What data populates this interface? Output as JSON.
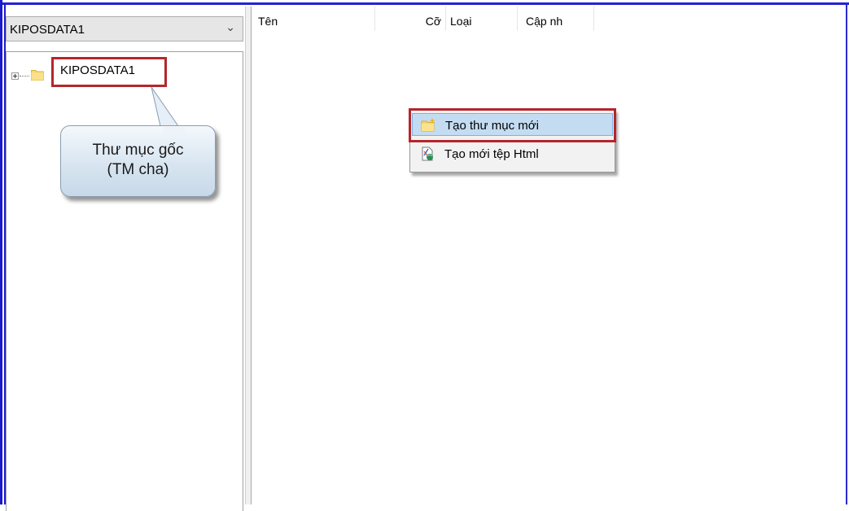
{
  "tree_panel": {
    "combo_value": "KIPOSDATA1",
    "combo_arrow_icon": "chevron-down-icon",
    "root_node_label": "KIPOSDATA1"
  },
  "callout": {
    "line1": "Thư mục gốc",
    "line2": "(TM cha)"
  },
  "file_list": {
    "columns": [
      "Tên",
      "Cỡ",
      "Loại",
      "Cập nh"
    ]
  },
  "context_menu": {
    "items": [
      {
        "label": "Tạo thư mục mới",
        "icon": "new-folder-icon",
        "highlighted": true
      },
      {
        "label": "Tạo mới tệp Html",
        "icon": "new-html-file-icon",
        "highlighted": false
      }
    ]
  },
  "colors": {
    "window_border": "#1b1bc9",
    "annotation_red": "#b5262b",
    "menu_highlight": "#c4dcf2",
    "folder_yellow": "#f6d66b"
  }
}
